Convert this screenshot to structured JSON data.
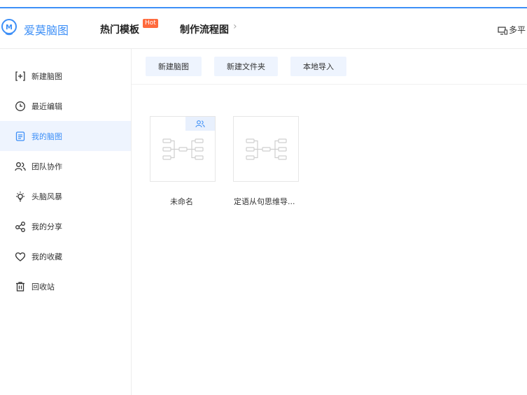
{
  "header": {
    "app_name": "爱莫脑图",
    "logo_letter": "M",
    "nav_templates": "热门模板",
    "hot_badge": "Hot",
    "nav_flowchart": "制作流程图",
    "multi_platform": "多平"
  },
  "sidebar": {
    "items": [
      {
        "label": "新建脑图",
        "icon": "new-plus-icon"
      },
      {
        "label": "最近编辑",
        "icon": "clock-icon"
      },
      {
        "label": "我的脑图",
        "icon": "document-icon",
        "active": true
      },
      {
        "label": "团队协作",
        "icon": "team-icon"
      },
      {
        "label": "头脑风暴",
        "icon": "lightbulb-icon"
      },
      {
        "label": "我的分享",
        "icon": "share-icon"
      },
      {
        "label": "我的收藏",
        "icon": "heart-icon"
      },
      {
        "label": "回收站",
        "icon": "trash-icon"
      }
    ]
  },
  "toolbar": {
    "new_map": "新建脑图",
    "new_folder": "新建文件夹",
    "local_import": "本地导入"
  },
  "files": [
    {
      "name": "未命名",
      "team": true
    },
    {
      "name": "定语从句思维导...",
      "team": false
    }
  ],
  "colors": {
    "accent": "#3d8ff7",
    "hot": "#ff6a3d",
    "active_bg": "#eef4fe"
  }
}
